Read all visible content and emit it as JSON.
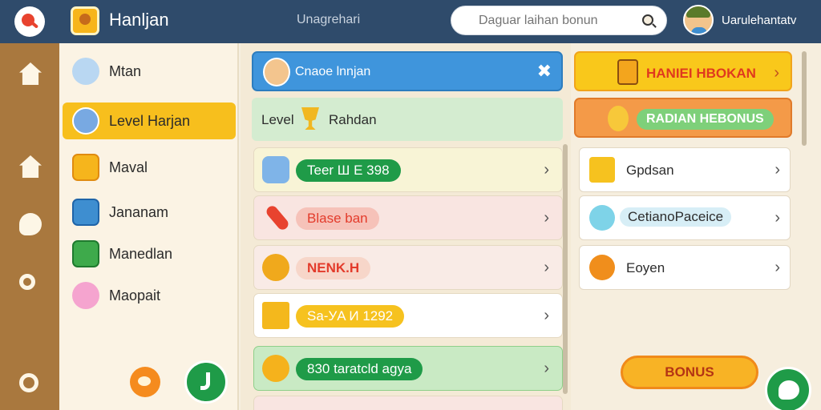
{
  "header": {
    "app_title": "Hanljan",
    "center_title": "Unagrehari",
    "search_placeholder": "Daguar laihan bonun",
    "username": "Uarulehantatv"
  },
  "sidebar": {
    "items": [
      {
        "label": "Mtan",
        "icon": "robot-icon"
      },
      {
        "label": "Level Harjan",
        "icon": "character-icon",
        "active": true
      },
      {
        "label": "Maval",
        "icon": "crown-icon"
      },
      {
        "label": "Jananam",
        "icon": "grid-icon"
      },
      {
        "label": "Manedlan",
        "icon": "check-icon"
      },
      {
        "label": "Maopait",
        "icon": "piggy-icon"
      }
    ]
  },
  "middle": {
    "banner_text": "Cnaoe lnnjan",
    "level_label": "Level",
    "level_name": "Rahdan",
    "rows": [
      {
        "pill": "Teer Ш Е 398",
        "pill_color": "#1f9b48",
        "text_color": "#ffffff",
        "bg": "#f8f4d6"
      },
      {
        "pill": "Blase ban",
        "pill_color": "#f6c2b9",
        "text_color": "#e33b2b",
        "bg": "#f9e5e1"
      },
      {
        "pill": "NENK.H",
        "pill_color": "#f7d6c9",
        "text_color": "#e33b2b",
        "bg": "#f9ebe6"
      },
      {
        "pill": "Sa-УA И 1292",
        "pill_color": "#f6c21f",
        "text_color": "#ffffff",
        "bg": "#ffffff"
      },
      {
        "pill": "830 taratcld agya",
        "pill_color": "#1f9b48",
        "text_color": "#ffffff",
        "bg": "#c9eac4"
      }
    ]
  },
  "right": {
    "top_button": "HANIEI HBOKAN",
    "bonus_banner": "RADIAN HEBONUS",
    "rows": [
      {
        "label": "Gpdsan",
        "icon": "star-icon"
      },
      {
        "label": "CetianoPaceice",
        "icon": "key-icon"
      },
      {
        "label": "Eoyen",
        "icon": "coin-icon"
      }
    ],
    "bonus_button": "BONUS"
  }
}
